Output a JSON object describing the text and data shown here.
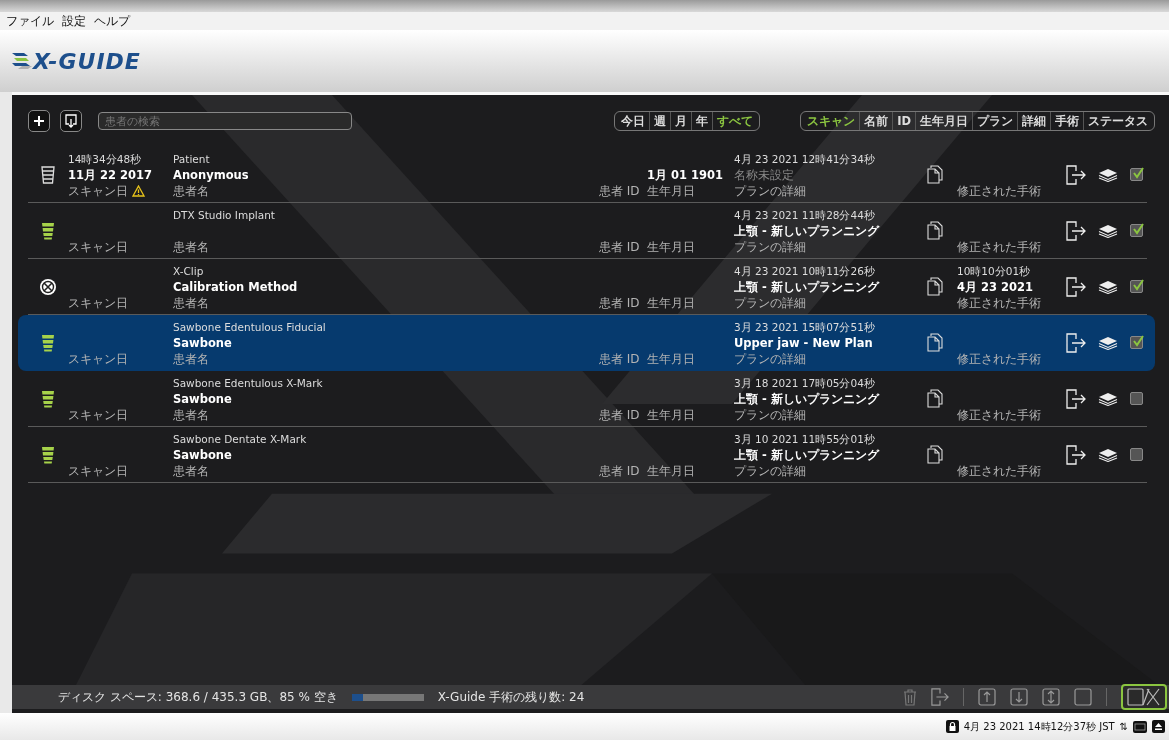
{
  "menu": [
    "ファイル",
    "設定",
    "ヘルプ"
  ],
  "logo": {
    "text": "X-GUIDE"
  },
  "search": {
    "placeholder": "患者の検索"
  },
  "date_filters": [
    {
      "label": "今日",
      "selected": false
    },
    {
      "label": "週",
      "selected": false
    },
    {
      "label": "月",
      "selected": false
    },
    {
      "label": "年",
      "selected": false
    },
    {
      "label": "すべて",
      "selected": true
    }
  ],
  "sort_columns": [
    {
      "label": "スキャン",
      "selected": true
    },
    {
      "label": "名前",
      "selected": false
    },
    {
      "label": "ID",
      "selected": false
    },
    {
      "label": "生年月日",
      "selected": false
    },
    {
      "label": "プラン",
      "selected": false
    },
    {
      "label": "詳細",
      "selected": false
    },
    {
      "label": "手術",
      "selected": false
    },
    {
      "label": "ステータス",
      "selected": false
    }
  ],
  "rows": [
    {
      "kind": "implant-outline",
      "scan_time": "14時34分48秒",
      "scan_date": "11月 22 2017",
      "scan_label": "スキャン日",
      "warning": true,
      "name_top": "Patient",
      "name": "Anonymous",
      "name_label": "患者名",
      "id_label": "患者 ID",
      "birth": "1月 01 1901",
      "birth_label": "生年月日",
      "plan_date": "4月 23 2021 12時41分34秒",
      "plan_name": "名称未設定",
      "plan_unnamed": true,
      "plan_label": "プランの詳細",
      "surgery_label": "修正された手術",
      "selected": false,
      "checked": true
    },
    {
      "kind": "implant",
      "scan_label": "スキャン日",
      "warning": false,
      "name_top": "DTX Studio Implant",
      "name_label": "患者名",
      "id_label": "患者 ID",
      "birth_label": "生年月日",
      "plan_date": "4月 23 2021 11時28分44秒",
      "plan_name": "上顎 - 新しいプランニング",
      "plan_unnamed": false,
      "plan_label": "プランの詳細",
      "surgery_label": "修正された手術",
      "selected": false,
      "checked": true
    },
    {
      "kind": "xclip",
      "scan_label": "スキャン日",
      "warning": false,
      "name_top": "X-Clip",
      "name": "Calibration Method",
      "name_label": "患者名",
      "id_label": "患者 ID",
      "birth_label": "生年月日",
      "plan_date": "4月 23 2021 10時11分26秒",
      "plan_name": "上顎 - 新しいプランニング",
      "plan_unnamed": false,
      "plan_label": "プランの詳細",
      "surgery_time": "10時10分01秒",
      "surgery_date": "4月 23 2021",
      "surgery_label": "修正された手術",
      "selected": false,
      "checked": true
    },
    {
      "kind": "implant",
      "scan_label": "スキャン日",
      "warning": false,
      "name_top": "Sawbone Edentulous Fiducial",
      "name": "Sawbone",
      "name_label": "患者名",
      "id_label": "患者 ID",
      "birth_label": "生年月日",
      "plan_date": "3月 23 2021 15時07分51秒",
      "plan_name": "Upper jaw - New Plan",
      "plan_unnamed": false,
      "plan_label": "プランの詳細",
      "surgery_label": "修正された手術",
      "selected": true,
      "checked": true
    },
    {
      "kind": "implant",
      "scan_label": "スキャン日",
      "warning": false,
      "name_top": "Sawbone Edentulous X-Mark",
      "name": "Sawbone",
      "name_label": "患者名",
      "id_label": "患者 ID",
      "birth_label": "生年月日",
      "plan_date": "3月 18 2021 17時05分04秒",
      "plan_name": "上顎 - 新しいプランニング",
      "plan_unnamed": false,
      "plan_label": "プランの詳細",
      "surgery_label": "修正された手術",
      "selected": false,
      "checked": false
    },
    {
      "kind": "implant",
      "scan_label": "スキャン日",
      "warning": false,
      "name_top": "Sawbone Dentate X-Mark",
      "name": "Sawbone",
      "name_label": "患者名",
      "id_label": "患者 ID",
      "birth_label": "生年月日",
      "plan_date": "3月 10 2021 11時55分01秒",
      "plan_name": "上顎 - 新しいプランニング",
      "plan_unnamed": false,
      "plan_label": "プランの詳細",
      "surgery_label": "修正された手術",
      "selected": false,
      "checked": false
    }
  ],
  "footer": {
    "disk_text": "ディスク スペース: 368.6 / 435.3 GB、85 % 空き",
    "disk_used": {
      "level": 0.15
    },
    "remaining": "X-Guide 手術の残り数: 24"
  },
  "tray": {
    "datetime": "4月 23 2021 14時12分37秒 JST",
    "network_glyph": "⇅"
  }
}
